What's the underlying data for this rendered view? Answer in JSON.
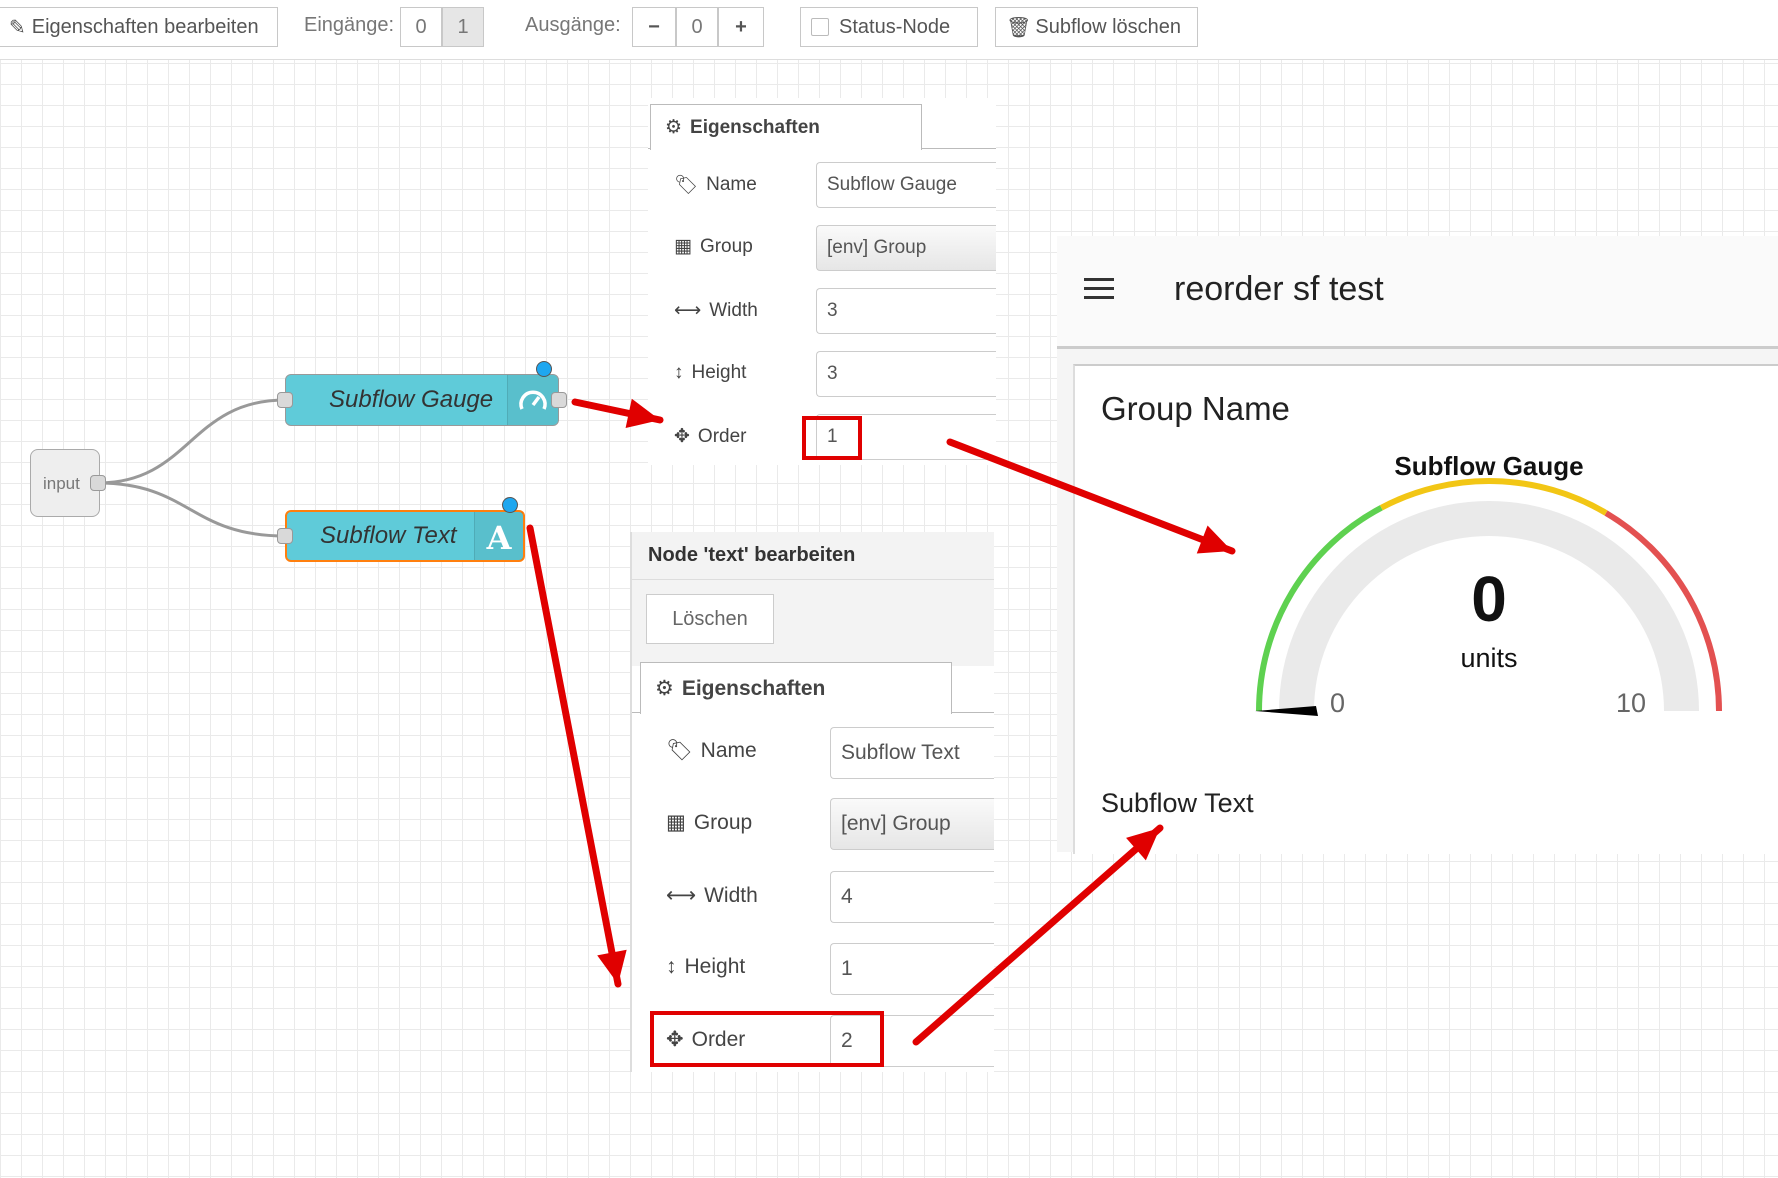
{
  "toolbar": {
    "edit_properties": "Eigenschaften bearbeiten",
    "inputs_label": "Eingänge:",
    "inputs_options": [
      "0",
      "1"
    ],
    "outputs_label": "Ausgänge:",
    "outputs_minus": "−",
    "outputs_value": "0",
    "outputs_plus": "+",
    "status_node": "Status-Node",
    "delete_subflow": "Subflow löschen"
  },
  "flow": {
    "input_node": "input",
    "gauge_node": "Subflow Gauge",
    "text_node": "Subflow Text"
  },
  "gauge_panel": {
    "tab": "Eigenschaften",
    "name_label": "Name",
    "name_value": "Subflow Gauge",
    "group_label": "Group",
    "group_value": "[env] Group",
    "width_label": "Width",
    "width_value": "3",
    "height_label": "Height",
    "height_value": "3",
    "order_label": "Order",
    "order_value": "1"
  },
  "text_panel": {
    "title": "Node 'text' bearbeiten",
    "delete_button": "Löschen",
    "tab": "Eigenschaften",
    "name_label": "Name",
    "name_value": "Subflow Text",
    "group_label": "Group",
    "group_value": "[env] Group",
    "width_label": "Width",
    "width_value": "4",
    "height_label": "Height",
    "height_value": "1",
    "order_label": "Order",
    "order_value": "2"
  },
  "dashboard": {
    "title": "reorder sf test",
    "group_name": "Group Name",
    "gauge_title": "Subflow Gauge",
    "gauge_value": "0",
    "gauge_units": "units",
    "gauge_min": "0",
    "gauge_max": "10",
    "text_widget": "Subflow Text",
    "colors": {
      "green": "#5ed150",
      "yellow": "#f2c615",
      "red": "#e35151",
      "arrow": "#e00000"
    }
  }
}
